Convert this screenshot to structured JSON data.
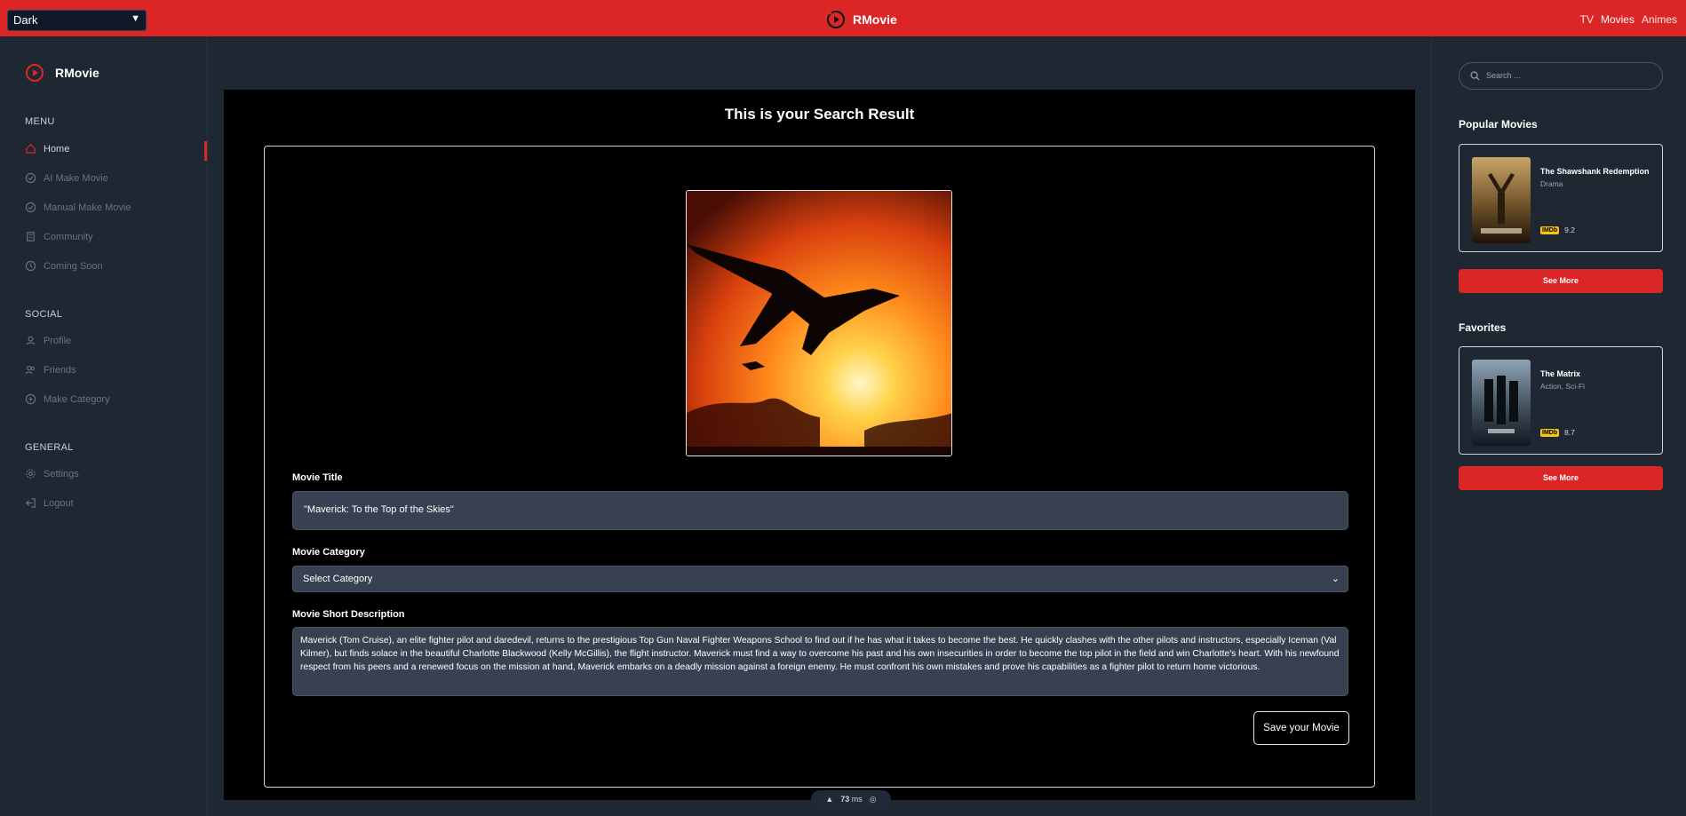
{
  "topbar": {
    "theme_value": "Dark",
    "app_name": "RMovie",
    "links": [
      "TV",
      "Movies",
      "Animes"
    ]
  },
  "sidebar": {
    "app_name": "RMovie",
    "sections": [
      {
        "title": "MENU",
        "items": [
          {
            "label": "Home",
            "icon": "home-icon"
          },
          {
            "label": "AI Make Movie",
            "icon": "check-circle-icon"
          },
          {
            "label": "Manual Make Movie",
            "icon": "check-circle-icon"
          },
          {
            "label": "Community",
            "icon": "building-icon"
          },
          {
            "label": "Coming Soon",
            "icon": "clock-icon"
          }
        ]
      },
      {
        "title": "SOCIAL",
        "items": [
          {
            "label": "Profile",
            "icon": "user-icon"
          },
          {
            "label": "Friends",
            "icon": "users-icon"
          },
          {
            "label": "Make Category",
            "icon": "circle-plus-icon"
          }
        ]
      },
      {
        "title": "GENERAL",
        "items": [
          {
            "label": "Settings",
            "icon": "gear-icon"
          },
          {
            "label": "Logout",
            "icon": "logout-icon"
          }
        ]
      }
    ]
  },
  "main": {
    "title": "This is your Search Result",
    "title_label": "Movie Title",
    "title_value": "\"Maverick: To the Top of the Skies\"",
    "category_label": "Movie Category",
    "category_value": "Select Category",
    "description_label": "Movie Short Description",
    "description_value": "Maverick (Tom Cruise), an elite fighter pilot and daredevil, returns to the prestigious Top Gun Naval Fighter Weapons School to find out if he has what it takes to become the best. He quickly clashes with the other pilots and instructors, especially Iceman (Val Kilmer), but finds solace in the beautiful Charlotte Blackwood (Kelly McGillis), the flight instructor. Maverick must find a way to overcome his past and his own insecurities in order to become the top pilot in the field and win Charlotte's heart. With his newfound respect from his peers and a renewed focus on the mission at hand, Maverick embarks on a deadly mission against a foreign enemy. He must confront his own mistakes and prove his capabilities as a fighter pilot to return home victorious.",
    "save_label": "Save your Movie"
  },
  "perf": {
    "value": "73",
    "unit": "ms"
  },
  "rightbar": {
    "search_placeholder": "Search ...",
    "popular_title": "Popular Movies",
    "popular": {
      "title": "The Shawshank Redemption",
      "genre": "Drama",
      "badge": "IMDb",
      "rating": "9.2"
    },
    "favorites_title": "Favorites",
    "favorite": {
      "title": "The Matrix",
      "genre": "Action, Sci-Fi",
      "badge": "IMDb",
      "rating": "8.7"
    },
    "see_more_label": "See More"
  },
  "colors": {
    "accent": "#dc2626",
    "background": "#1f2733",
    "panel": "#000000",
    "input": "#374151"
  }
}
